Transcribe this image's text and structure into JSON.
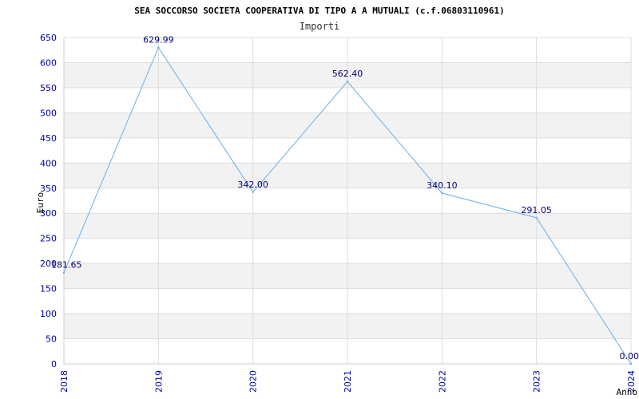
{
  "chart_data": {
    "type": "line",
    "title": "SEA SOCCORSO SOCIETA COOPERATIVA DI TIPO A A MUTUALI (c.f.06803110961)",
    "subtitle": "Importi",
    "xlabel": "Anno",
    "ylabel": "Euro",
    "ylim": [
      0,
      650
    ],
    "yticks": [
      "0",
      "50",
      "100",
      "150",
      "200",
      "250",
      "300",
      "350",
      "400",
      "450",
      "500",
      "550",
      "600",
      "650"
    ],
    "categories": [
      "2018",
      "2019",
      "2020",
      "2021",
      "2022",
      "2023",
      "2024"
    ],
    "series": [
      {
        "values": [
          181.65,
          629.99,
          342.0,
          562.4,
          340.1,
          291.05,
          0.0
        ],
        "labels": [
          "181.65",
          "629.99",
          "342.00",
          "562.40",
          "340.10",
          "291.05",
          "0.00"
        ]
      }
    ],
    "grid": true,
    "colors": {
      "line": "#6aaee8",
      "band": "#f2f2f2",
      "grid": "#dddddd",
      "tick": "#0000aa"
    }
  }
}
